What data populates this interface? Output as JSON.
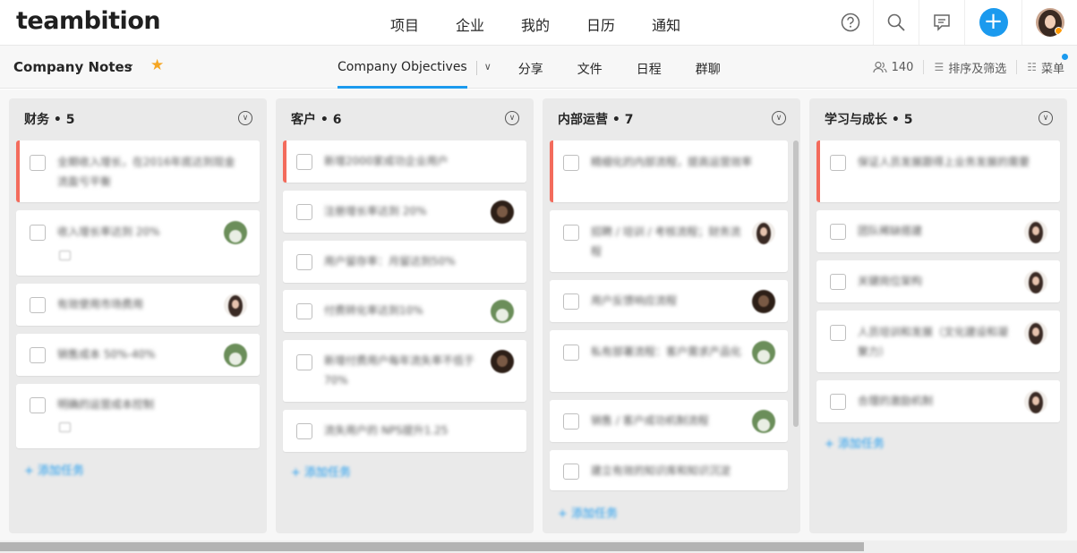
{
  "app": {
    "logo": "teambition"
  },
  "nav": {
    "items": [
      "项目",
      "企业",
      "我的",
      "日历",
      "通知"
    ]
  },
  "topbar_icons": [
    "help-icon",
    "search-icon",
    "chat-icon",
    "add-icon",
    "avatar"
  ],
  "project": {
    "title": "Company Notes",
    "chevron": "⌄",
    "star": "★"
  },
  "tabs": {
    "active": "Company Objectives",
    "items": [
      "分享",
      "文件",
      "日程",
      "群聊"
    ]
  },
  "toolbar": {
    "members_count": "140",
    "sort_filter": "排序及筛选",
    "menu": "菜单"
  },
  "colors": {
    "accent": "#1b9aee",
    "priority": "#f36b5c",
    "star": "#f5a623"
  },
  "columns": [
    {
      "title": "财务 • 5",
      "add_task": "添加任务",
      "cards": [
        {
          "text": "全期收入增长，在2016年底达到现金流盈亏平衡",
          "priority": true
        },
        {
          "text": "收入增长率达到 20%",
          "avatar": "green",
          "note": true
        },
        {
          "text": "有效使用市场费用",
          "avatar": "girl"
        },
        {
          "text": "销售成本 50%-40%",
          "avatar": "green"
        },
        {
          "text": "明确的运营成本控制",
          "note": true
        }
      ]
    },
    {
      "title": "客户 • 6",
      "add_task": "添加任务",
      "cards": [
        {
          "text": "新增2000家成功企业用户",
          "priority": true
        },
        {
          "text": "注册增长率达到 20%",
          "avatar": "dark"
        },
        {
          "text": "用户留存率：月留达到50%"
        },
        {
          "text": "付费转化率达到10%",
          "avatar": "green"
        },
        {
          "text": "新增付费用户每年流失率不低于70%",
          "avatar": "dark"
        },
        {
          "text": "流失用户的 NPS提升1.25"
        }
      ]
    },
    {
      "title": "内部运营 • 7",
      "add_task": "添加任务",
      "cards": [
        {
          "text": "精细化的内部流程，提高运营效率",
          "priority": true
        },
        {
          "text": "招聘 / 培训 / 考核流程；财务流程",
          "avatar": "girl"
        },
        {
          "text": "用户反馈响应流程",
          "avatar": "dark"
        },
        {
          "text": "私有部署流程：客户需求产品化",
          "avatar": "green"
        },
        {
          "text": "销售 / 客户成功机制流程",
          "avatar": "green"
        },
        {
          "text": "建立有效的知识库和知识沉淀"
        }
      ]
    },
    {
      "title": "学习与成长 • 5",
      "add_task": "添加任务",
      "cards": [
        {
          "text": "保证人员发展跟得上业务发展的需要",
          "priority": true
        },
        {
          "text": "团队稀缺搭建",
          "avatar": "girl"
        },
        {
          "text": "关键岗位架构",
          "avatar": "girl"
        },
        {
          "text": "人员培训和发展（文化建设和凝聚力）",
          "avatar": "girl"
        },
        {
          "text": "合理的激励机制",
          "avatar": "girl"
        }
      ]
    }
  ]
}
